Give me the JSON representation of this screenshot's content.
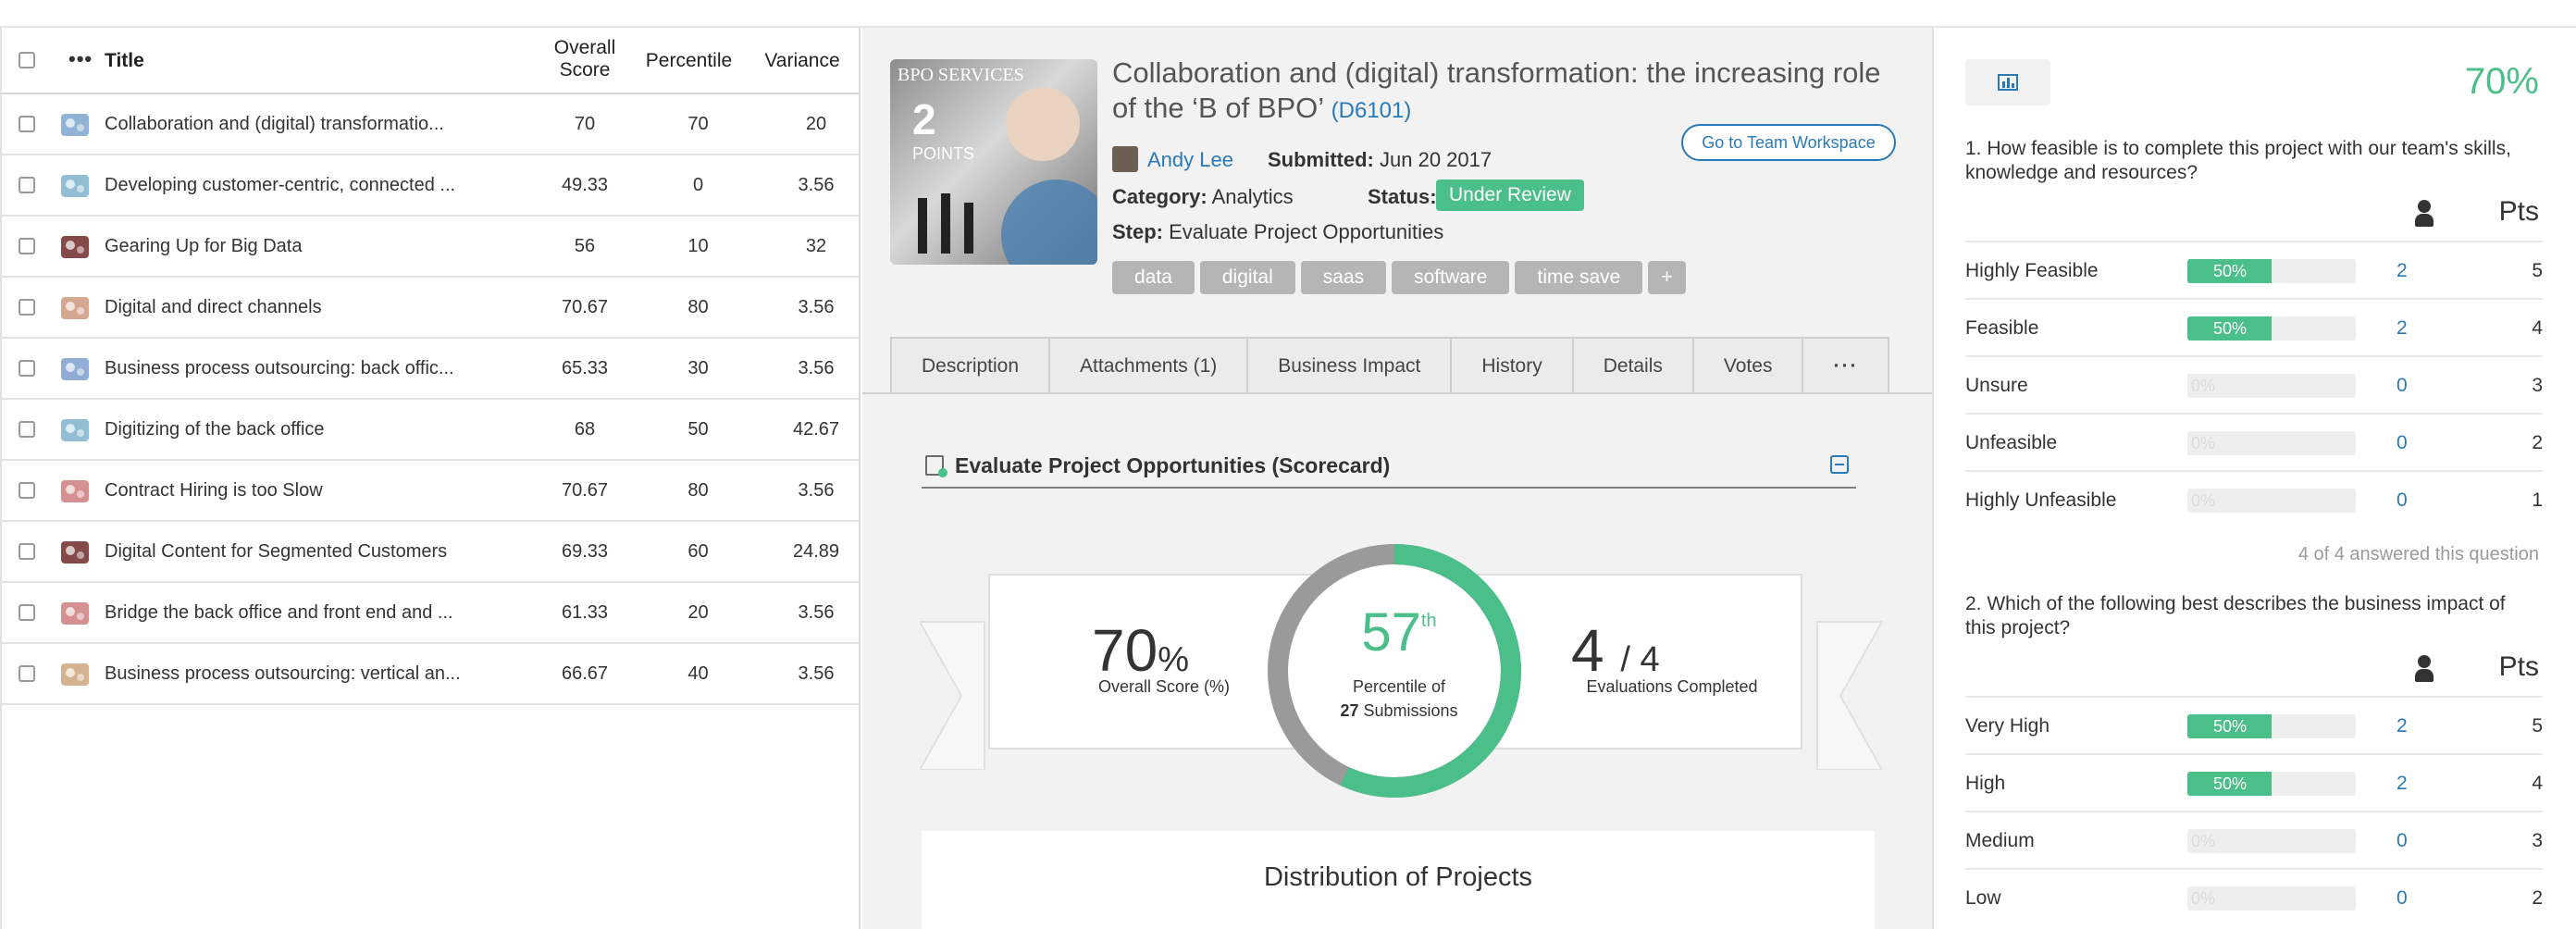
{
  "table": {
    "headers": {
      "title": "Title",
      "score": "Overall Score",
      "percentile": "Percentile",
      "variance": "Variance"
    },
    "rows": [
      {
        "title": "Collaboration and (digital) transformatio...",
        "score": "70",
        "percentile": "70",
        "variance": "20",
        "thumb": "people-icon"
      },
      {
        "title": "Developing customer-centric, connected ...",
        "score": "49.33",
        "percentile": "0",
        "variance": "3.56",
        "thumb": "cloud-icon"
      },
      {
        "title": "Gearing Up for Big Data",
        "score": "56",
        "percentile": "10",
        "variance": "32",
        "thumb": "hardware-icon"
      },
      {
        "title": "Digital and direct channels",
        "score": "70.67",
        "percentile": "80",
        "variance": "3.56",
        "thumb": "network-icon"
      },
      {
        "title": "Business process outsourcing: back offic...",
        "score": "65.33",
        "percentile": "30",
        "variance": "3.56",
        "thumb": "org-chart-icon"
      },
      {
        "title": "Digitizing of the back office",
        "score": "68",
        "percentile": "50",
        "variance": "42.67",
        "thumb": "tree-icon"
      },
      {
        "title": "Contract Hiring is too Slow",
        "score": "70.67",
        "percentile": "80",
        "variance": "3.56",
        "thumb": "document-icon"
      },
      {
        "title": "Digital Content for Segmented Customers",
        "score": "69.33",
        "percentile": "60",
        "variance": "24.89",
        "thumb": "share-icon"
      },
      {
        "title": "Bridge the back office and front end and ...",
        "score": "61.33",
        "percentile": "20",
        "variance": "3.56",
        "thumb": "screen-icon"
      },
      {
        "title": "Business process outsourcing: vertical an...",
        "score": "66.67",
        "percentile": "40",
        "variance": "3.56",
        "thumb": "gears-icon"
      }
    ]
  },
  "project": {
    "image_label": "BPO SERVICES",
    "points": "2",
    "points_label": "POINTS",
    "title": "Collaboration and (digital) transformation: the increasing role of the ‘B of BPO’",
    "id": "D6101",
    "workspace_button": "Go to Team Workspace",
    "author": "Andy Lee",
    "submitted_label": "Submitted:",
    "submitted": "Jun 20 2017",
    "category_label": "Category:",
    "category": "Analytics",
    "status_label": "Status:",
    "status": "Under Review",
    "step_label": "Step:",
    "step": "Evaluate Project Opportunities",
    "tags": [
      "data",
      "digital",
      "saas",
      "software",
      "time save",
      "+"
    ]
  },
  "tabs": [
    "Description",
    "Attachments (1)",
    "Business Impact",
    "History",
    "Details",
    "Votes",
    "···"
  ],
  "scorecard": {
    "title": "Evaluate Project Opportunities (Scorecard)",
    "overall_value": "70",
    "overall_unit": "%",
    "overall_label": "Overall Score (%)",
    "percentile_value": "57",
    "percentile_suffix": "th",
    "percentile_fraction": 0.57,
    "percentile_label": "Percentile of",
    "submissions_count": "27",
    "submissions_label": "Submissions",
    "evals_done": "4",
    "evals_total": "/ 4",
    "evals_label": "Evaluations Completed",
    "distribution_title": "Distribution of Projects"
  },
  "right": {
    "overall": "70%",
    "pts_header": "Pts",
    "questions": [
      {
        "text": "1. How feasible is to complete this project with our team's skills, knowledge and resources?",
        "answers": [
          {
            "label": "Highly Feasible",
            "pct": "50%",
            "fill": 0.5,
            "count": "2",
            "pts": "5"
          },
          {
            "label": "Feasible",
            "pct": "50%",
            "fill": 0.5,
            "count": "2",
            "pts": "4"
          },
          {
            "label": "Unsure",
            "pct": "0%",
            "fill": 0,
            "count": "0",
            "pts": "3"
          },
          {
            "label": "Unfeasible",
            "pct": "0%",
            "fill": 0,
            "count": "0",
            "pts": "2"
          },
          {
            "label": "Highly Unfeasible",
            "pct": "0%",
            "fill": 0,
            "count": "0",
            "pts": "1"
          }
        ],
        "answered": "4 of 4 answered this question"
      },
      {
        "text": "2. Which of the following best describes the business impact of this project?",
        "answers": [
          {
            "label": "Very High",
            "pct": "50%",
            "fill": 0.5,
            "count": "2",
            "pts": "5"
          },
          {
            "label": "High",
            "pct": "50%",
            "fill": 0.5,
            "count": "2",
            "pts": "4"
          },
          {
            "label": "Medium",
            "pct": "0%",
            "fill": 0,
            "count": "0",
            "pts": "3"
          },
          {
            "label": "Low",
            "pct": "0%",
            "fill": 0,
            "count": "0",
            "pts": "2"
          }
        ]
      }
    ]
  },
  "colors": {
    "accent": "#4bbf89",
    "link": "#2a7ab8",
    "ring_track": "#9a9a9a"
  }
}
